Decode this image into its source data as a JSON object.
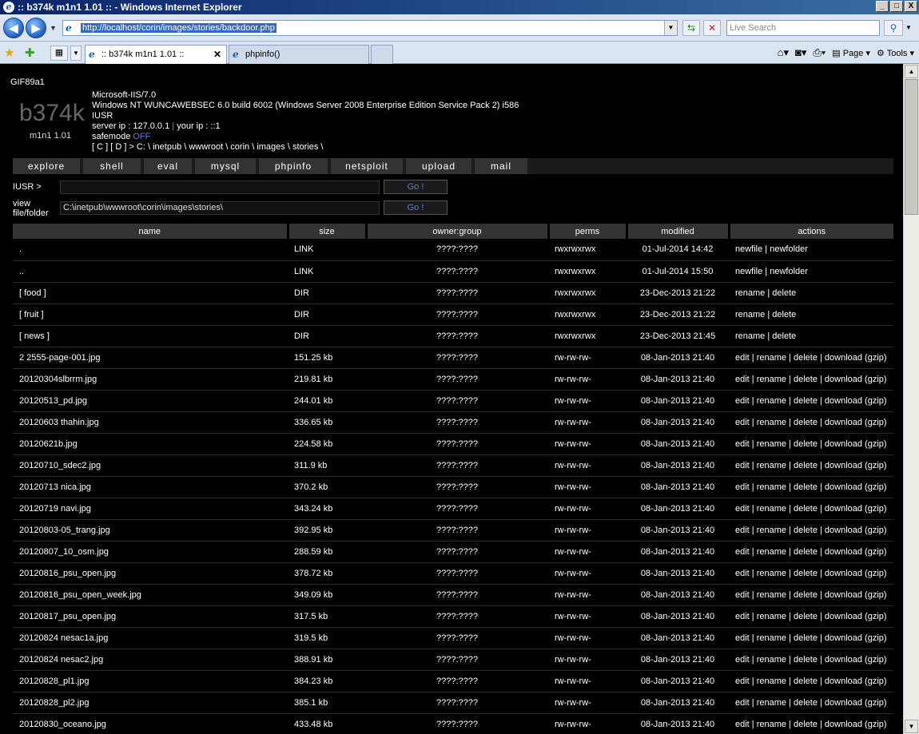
{
  "window": {
    "title": ":: b374k m1n1 1.01 :: - Windows Internet Explorer",
    "min": "_",
    "max": "□",
    "close": "X"
  },
  "address": {
    "url": "http://localhost/corin/images/stories/backdoor.php",
    "search_placeholder": "Live Search"
  },
  "tabs": [
    {
      "label": ":: b374k m1n1 1.01 ::"
    },
    {
      "label": "phpinfo()"
    }
  ],
  "commands": {
    "page": "Page",
    "tools": "Tools"
  },
  "shell": {
    "gif": "GIF89a1",
    "logo": "b374k",
    "version": "m1n1 1.01",
    "server": "Microsoft-IIS/7.0",
    "os": "Windows NT WUNCAWEBSEC 6.0 build 6002 (Windows Server 2008 Enterprise Edition Service Pack 2) i586",
    "user": "IUSR",
    "ips": "server ip : 127.0.0.1",
    "ip_sep": " | ",
    "your_ip": "your ip : ::1",
    "safemode_label": "safemode",
    "safemode_value": "OFF",
    "path": "[ C ] [ D ]  > C: \\ inetpub \\ wwwroot \\ corin \\ images \\ stories \\"
  },
  "menu": [
    "explore",
    "shell",
    "eval",
    "mysql",
    "phpinfo",
    "netsploit",
    "upload",
    "mail"
  ],
  "cmd": {
    "prompt": "IUSR >",
    "go": "Go !",
    "view_label_1": "view",
    "view_label_2": "file/folder",
    "view_value": "C:\\inetpub\\wwwroot\\corin\\images\\stories\\"
  },
  "table": {
    "headers": [
      "name",
      "size",
      "owner:group",
      "perms",
      "modified",
      "actions"
    ],
    "rows": [
      [
        ".",
        "LINK",
        "????:????",
        "rwxrwxrwx",
        "01-Jul-2014 14:42",
        "newfile | newfolder"
      ],
      [
        "..",
        "LINK",
        "????:????",
        "rwxrwxrwx",
        "01-Jul-2014 15:50",
        "newfile | newfolder"
      ],
      [
        "[ food ]",
        "DIR",
        "????:????",
        "rwxrwxrwx",
        "23-Dec-2013 21:22",
        "rename | delete"
      ],
      [
        "[ fruit ]",
        "DIR",
        "????:????",
        "rwxrwxrwx",
        "23-Dec-2013 21:22",
        "rename | delete"
      ],
      [
        "[ news ]",
        "DIR",
        "????:????",
        "rwxrwxrwx",
        "23-Dec-2013 21:45",
        "rename | delete"
      ],
      [
        "2 2555-page-001.jpg",
        "151.25 kb",
        "????:????",
        "rw-rw-rw-",
        "08-Jan-2013 21:40",
        "edit | rename | delete | download (gzip)"
      ],
      [
        "20120304slbrrm.jpg",
        "219.81 kb",
        "????:????",
        "rw-rw-rw-",
        "08-Jan-2013 21:40",
        "edit | rename | delete | download (gzip)"
      ],
      [
        "20120513_pd.jpg",
        "244.01 kb",
        "????:????",
        "rw-rw-rw-",
        "08-Jan-2013 21:40",
        "edit | rename | delete | download (gzip)"
      ],
      [
        "20120603 thahin.jpg",
        "336.65 kb",
        "????:????",
        "rw-rw-rw-",
        "08-Jan-2013 21:40",
        "edit | rename | delete | download (gzip)"
      ],
      [
        "20120621b.jpg",
        "224.58 kb",
        "????:????",
        "rw-rw-rw-",
        "08-Jan-2013 21:40",
        "edit | rename | delete | download (gzip)"
      ],
      [
        "20120710_sdec2.jpg",
        "311.9 kb",
        "????:????",
        "rw-rw-rw-",
        "08-Jan-2013 21:40",
        "edit | rename | delete | download (gzip)"
      ],
      [
        "20120713 nica.jpg",
        "370.2 kb",
        "????:????",
        "rw-rw-rw-",
        "08-Jan-2013 21:40",
        "edit | rename | delete | download (gzip)"
      ],
      [
        "20120719 navi.jpg",
        "343.24 kb",
        "????:????",
        "rw-rw-rw-",
        "08-Jan-2013 21:40",
        "edit | rename | delete | download (gzip)"
      ],
      [
        "20120803-05_trang.jpg",
        "392.95 kb",
        "????:????",
        "rw-rw-rw-",
        "08-Jan-2013 21:40",
        "edit | rename | delete | download (gzip)"
      ],
      [
        "20120807_10_osm.jpg",
        "288.59 kb",
        "????:????",
        "rw-rw-rw-",
        "08-Jan-2013 21:40",
        "edit | rename | delete | download (gzip)"
      ],
      [
        "20120816_psu_open.jpg",
        "378.72 kb",
        "????:????",
        "rw-rw-rw-",
        "08-Jan-2013 21:40",
        "edit | rename | delete | download (gzip)"
      ],
      [
        "20120816_psu_open_week.jpg",
        "349.09 kb",
        "????:????",
        "rw-rw-rw-",
        "08-Jan-2013 21:40",
        "edit | rename | delete | download (gzip)"
      ],
      [
        "20120817_psu_open.jpg",
        "317.5 kb",
        "????:????",
        "rw-rw-rw-",
        "08-Jan-2013 21:40",
        "edit | rename | delete | download (gzip)"
      ],
      [
        "20120824 nesac1a.jpg",
        "319.5 kb",
        "????:????",
        "rw-rw-rw-",
        "08-Jan-2013 21:40",
        "edit | rename | delete | download (gzip)"
      ],
      [
        "20120824 nesac2.jpg",
        "388.91 kb",
        "????:????",
        "rw-rw-rw-",
        "08-Jan-2013 21:40",
        "edit | rename | delete | download (gzip)"
      ],
      [
        "20120828_pl1.jpg",
        "384.23 kb",
        "????:????",
        "rw-rw-rw-",
        "08-Jan-2013 21:40",
        "edit | rename | delete | download (gzip)"
      ],
      [
        "20120828_pl2.jpg",
        "385.1 kb",
        "????:????",
        "rw-rw-rw-",
        "08-Jan-2013 21:40",
        "edit | rename | delete | download (gzip)"
      ],
      [
        "20120830_oceano.jpg",
        "433.48 kb",
        "????:????",
        "rw-rw-rw-",
        "08-Jan-2013 21:40",
        "edit | rename | delete | download (gzip)"
      ]
    ]
  }
}
